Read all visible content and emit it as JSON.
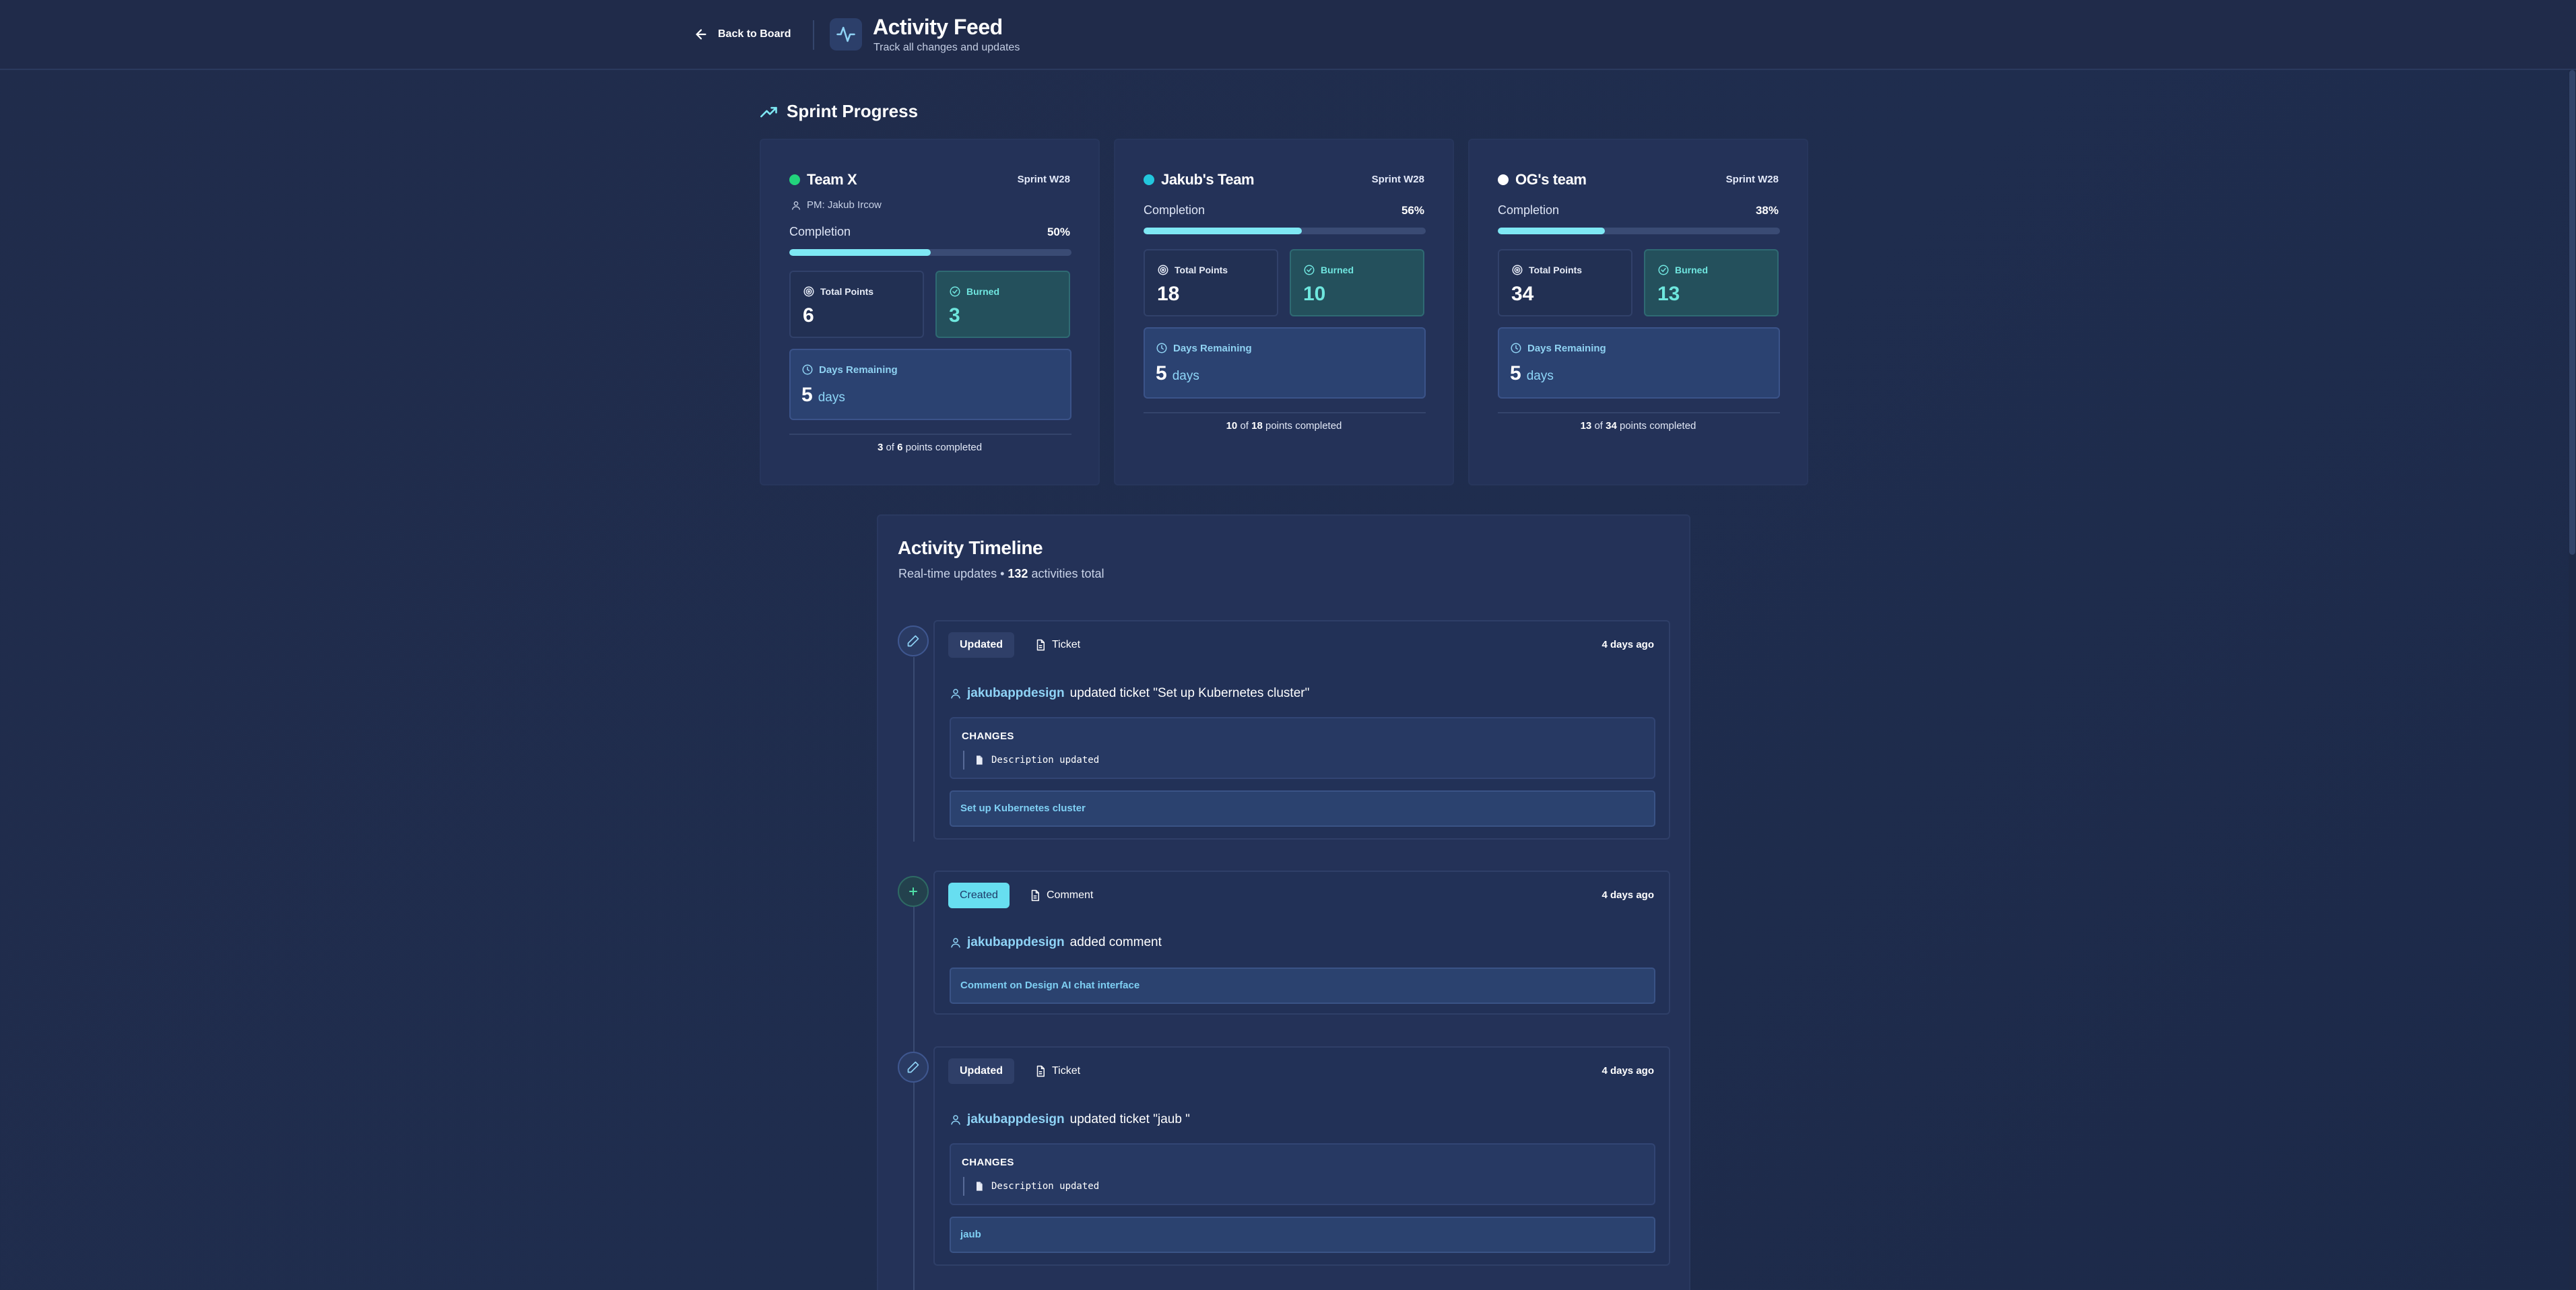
{
  "header": {
    "back_label": "Back to Board",
    "title": "Activity Feed",
    "subtitle": "Track all changes and updates"
  },
  "sprint": {
    "section_title": "Sprint Progress",
    "completion_label": "Completion",
    "total_points_label": "Total Points",
    "burned_label": "Burned",
    "days_remaining_label": "Days Remaining",
    "days_unit": "days",
    "of_word": "of",
    "points_completed_word": "points completed",
    "teams": [
      {
        "name": "Team X",
        "dot_color": "#22d37c",
        "sprint": "Sprint W28",
        "pm": "PM: Jakub Ircow",
        "completion_pct": "50%",
        "completion_fraction": 0.5,
        "total_points": "6",
        "burned": "3",
        "days_remaining": "5",
        "completed": "3",
        "total": "6"
      },
      {
        "name": "Jakub's Team",
        "dot_color": "#22c7dd",
        "sprint": "Sprint W28",
        "pm": "",
        "completion_pct": "56%",
        "completion_fraction": 0.56,
        "total_points": "18",
        "burned": "10",
        "days_remaining": "5",
        "completed": "10",
        "total": "18"
      },
      {
        "name": "OG's team",
        "dot_color": "#ffffff",
        "sprint": "Sprint W28",
        "pm": "",
        "completion_pct": "38%",
        "completion_fraction": 0.38,
        "total_points": "34",
        "burned": "13",
        "days_remaining": "5",
        "completed": "13",
        "total": "34"
      }
    ]
  },
  "timeline": {
    "title": "Activity Timeline",
    "subtitle_prefix": "Real-time updates •",
    "count": "132",
    "subtitle_suffix": "activities total",
    "changes_label": "CHANGES",
    "activities": [
      {
        "action": "Updated",
        "action_kind": "updated",
        "type": "Ticket",
        "time": "4 days ago",
        "actor": "jakubappdesign",
        "text": "updated ticket \"Set up Kubernetes cluster\"",
        "change": "Description updated",
        "link": "Set up Kubernetes cluster"
      },
      {
        "action": "Created",
        "action_kind": "created",
        "type": "Comment",
        "time": "4 days ago",
        "actor": "jakubappdesign",
        "text": "added comment",
        "change": "",
        "link": "Comment on Design AI chat interface"
      },
      {
        "action": "Updated",
        "action_kind": "updated",
        "type": "Ticket",
        "time": "4 days ago",
        "actor": "jakubappdesign",
        "text": "updated ticket \"jaub \"",
        "change": "Description updated",
        "link": "jaub"
      }
    ]
  },
  "colors": {
    "accent": "#7ee8f4",
    "link": "#8fd3f6",
    "burned": "#6ee7de",
    "background": "#202c4b"
  }
}
